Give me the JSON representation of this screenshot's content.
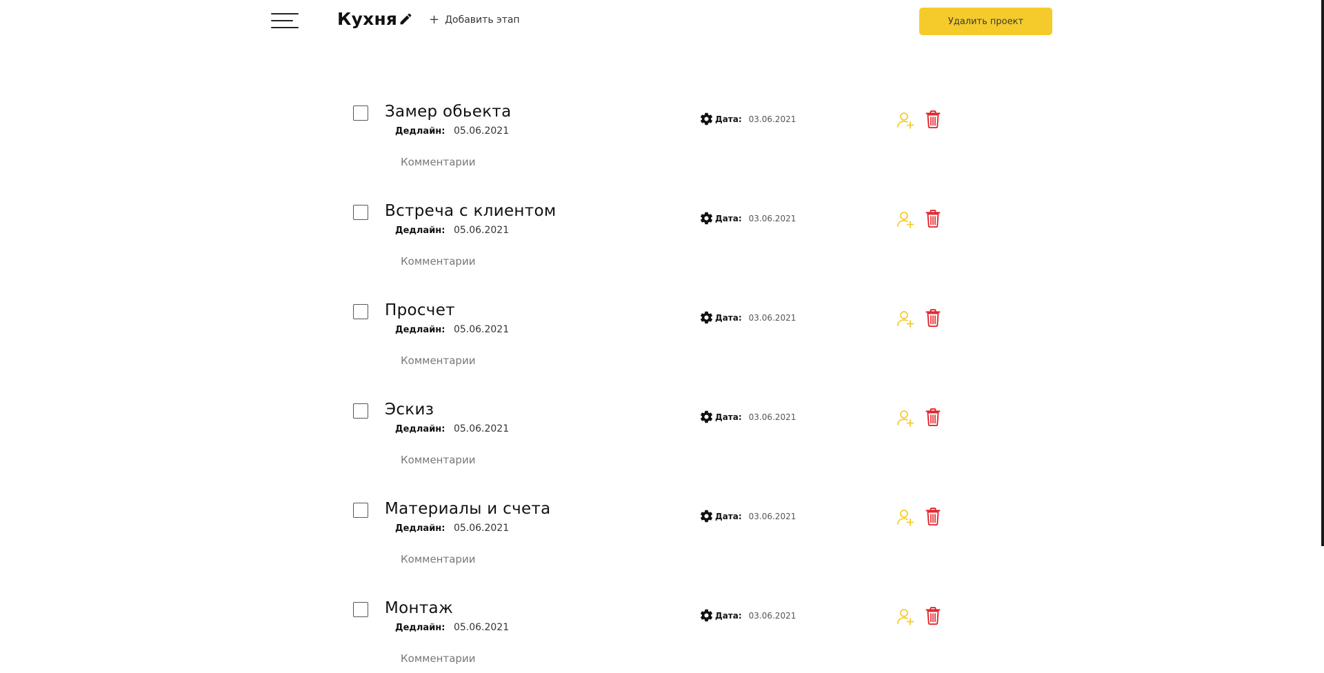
{
  "header": {
    "project_title": "Кухня",
    "add_stage_label": "Добавить этап",
    "delete_project_label": "Удалить проект"
  },
  "colors": {
    "accent": "#f5cb2c",
    "danger": "#e21b23",
    "text": "#111111"
  },
  "icons": {
    "menu": "hamburger-menu-icon",
    "edit": "pencil-icon",
    "add": "plus-icon",
    "settings": "gear-icon",
    "assign": "add-user-icon",
    "delete": "trash-icon"
  },
  "stages": [
    {
      "title": "Замер обьекта",
      "deadline_label": "Дедлайн:",
      "deadline": "05.06.2021",
      "date_label": "Дата:",
      "date": "03.06.2021",
      "comments_label": "Комментарии",
      "checked": false
    },
    {
      "title": "Встреча с клиентом",
      "deadline_label": "Дедлайн:",
      "deadline": "05.06.2021",
      "date_label": "Дата:",
      "date": "03.06.2021",
      "comments_label": "Комментарии",
      "checked": false
    },
    {
      "title": "Просчет",
      "deadline_label": "Дедлайн:",
      "deadline": "05.06.2021",
      "date_label": "Дата:",
      "date": "03.06.2021",
      "comments_label": "Комментарии",
      "checked": false
    },
    {
      "title": "Эскиз",
      "deadline_label": "Дедлайн:",
      "deadline": "05.06.2021",
      "date_label": "Дата:",
      "date": "03.06.2021",
      "comments_label": "Комментарии",
      "checked": false
    },
    {
      "title": "Материалы и счета",
      "deadline_label": "Дедлайн:",
      "deadline": "05.06.2021",
      "date_label": "Дата:",
      "date": "03.06.2021",
      "comments_label": "Комментарии",
      "checked": false
    },
    {
      "title": "Монтаж",
      "deadline_label": "Дедлайн:",
      "deadline": "05.06.2021",
      "date_label": "Дата:",
      "date": "03.06.2021",
      "comments_label": "Комментарии",
      "checked": false
    }
  ]
}
